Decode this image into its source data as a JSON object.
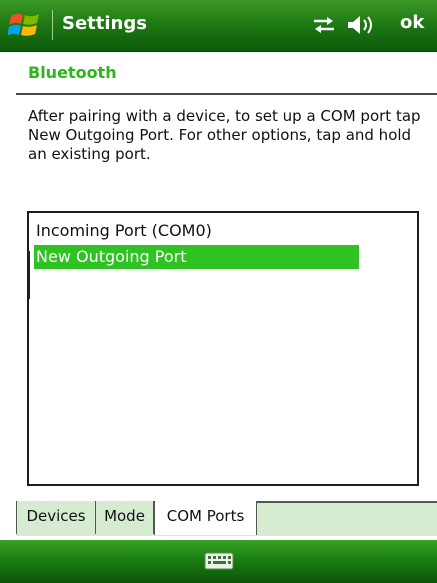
{
  "titlebar": {
    "start_icon": "windows-flag-icon",
    "title": "Settings",
    "status_icons": [
      "connectivity-icon",
      "volume-icon"
    ],
    "ok_label": "ok"
  },
  "section": {
    "title": "Bluetooth"
  },
  "instructions": "After pairing with a device, to set up a COM port tap New Outgoing Port. For other options, tap and hold an existing port.",
  "ports": {
    "items": [
      {
        "label": "Incoming Port (COM0)",
        "selected": false
      },
      {
        "label": "New Outgoing Port",
        "selected": true
      }
    ],
    "selection_color": "#2fc222"
  },
  "tabs": [
    {
      "label": "Devices",
      "active": false
    },
    {
      "label": "Mode",
      "active": false
    },
    {
      "label": "COM Ports",
      "active": true
    }
  ],
  "softbar": {
    "icon": "keyboard-icon"
  },
  "colors": {
    "accent_green": "#2db51b",
    "titlebar_green": "#1f7a14"
  }
}
